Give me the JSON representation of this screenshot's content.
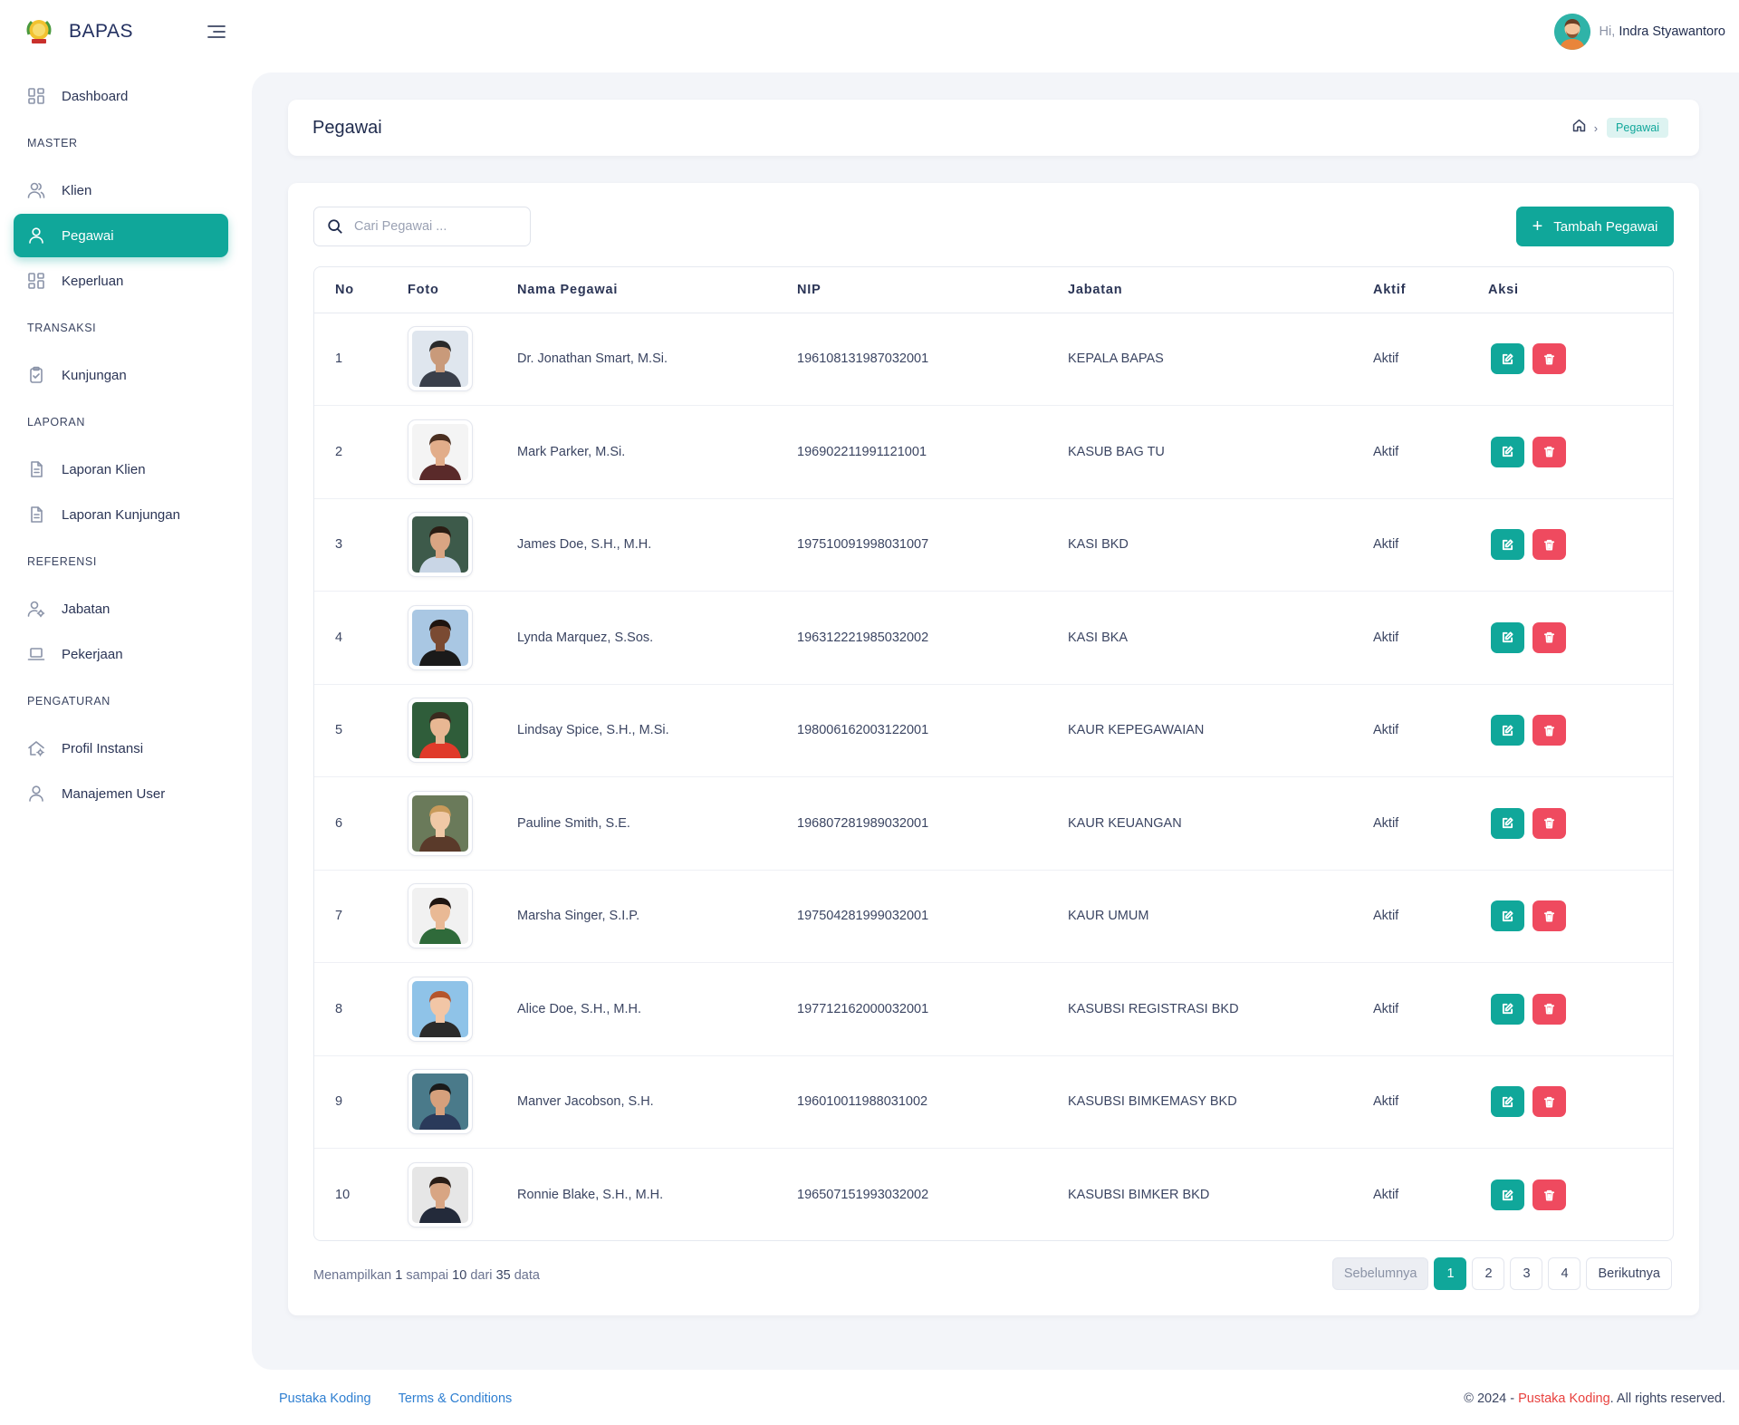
{
  "brand": {
    "name": "BAPAS"
  },
  "user": {
    "greeting": "Hi,",
    "name": "Indra Styawantoro"
  },
  "sidebar": {
    "dashboard": "Dashboard",
    "sections": {
      "master": "MASTER",
      "transaksi": "TRANSAKSI",
      "laporan": "LAPORAN",
      "referensi": "REFERENSI",
      "pengaturan": "PENGATURAN"
    },
    "items": {
      "klien": "Klien",
      "pegawai": "Pegawai",
      "keperluan": "Keperluan",
      "kunjungan": "Kunjungan",
      "laporan_klien": "Laporan Klien",
      "laporan_kunjungan": "Laporan Kunjungan",
      "jabatan": "Jabatan",
      "pekerjaan": "Pekerjaan",
      "profil_instansi": "Profil Instansi",
      "manajemen_user": "Manajemen User"
    }
  },
  "page": {
    "title": "Pegawai",
    "breadcrumb_current": "Pegawai"
  },
  "search": {
    "placeholder": "Cari Pegawai ..."
  },
  "add_button": {
    "label": "Tambah Pegawai"
  },
  "table": {
    "headers": {
      "no": "No",
      "foto": "Foto",
      "nama": "Nama Pegawai",
      "nip": "NIP",
      "jabatan": "Jabatan",
      "aktif": "Aktif",
      "aksi": "Aksi"
    },
    "rows": [
      {
        "no": "1",
        "nama": "Dr. Jonathan Smart, M.Si.",
        "nip": "196108131987032001",
        "jabatan": "KEPALA BAPAS",
        "aktif": "Aktif"
      },
      {
        "no": "2",
        "nama": "Mark Parker, M.Si.",
        "nip": "196902211991121001",
        "jabatan": "KASUB BAG TU",
        "aktif": "Aktif"
      },
      {
        "no": "3",
        "nama": "James Doe, S.H., M.H.",
        "nip": "197510091998031007",
        "jabatan": "KASI BKD",
        "aktif": "Aktif"
      },
      {
        "no": "4",
        "nama": "Lynda Marquez, S.Sos.",
        "nip": "196312221985032002",
        "jabatan": "KASI BKA",
        "aktif": "Aktif"
      },
      {
        "no": "5",
        "nama": "Lindsay Spice, S.H., M.Si.",
        "nip": "198006162003122001",
        "jabatan": "KAUR KEPEGAWAIAN",
        "aktif": "Aktif"
      },
      {
        "no": "6",
        "nama": "Pauline Smith, S.E.",
        "nip": "196807281989032001",
        "jabatan": "KAUR KEUANGAN",
        "aktif": "Aktif"
      },
      {
        "no": "7",
        "nama": "Marsha Singer, S.I.P.",
        "nip": "197504281999032001",
        "jabatan": "KAUR UMUM",
        "aktif": "Aktif"
      },
      {
        "no": "8",
        "nama": "Alice Doe, S.H., M.H.",
        "nip": "197712162000032001",
        "jabatan": "KASUBSI REGISTRASI BKD",
        "aktif": "Aktif"
      },
      {
        "no": "9",
        "nama": "Manver Jacobson, S.H.",
        "nip": "196010011988031002",
        "jabatan": "KASUBSI BIMKEMASY BKD",
        "aktif": "Aktif"
      },
      {
        "no": "10",
        "nama": "Ronnie Blake, S.H., M.H.",
        "nip": "196507151993032002",
        "jabatan": "KASUBSI BIMKER BKD",
        "aktif": "Aktif"
      }
    ]
  },
  "pagination": {
    "info_prefix": "Menampilkan",
    "from": "1",
    "info_to": "sampai",
    "to": "10",
    "info_of": "dari",
    "total": "35",
    "info_suffix": "data",
    "prev": "Sebelumnya",
    "next": "Berikutnya",
    "pages": [
      "1",
      "2",
      "3",
      "4"
    ],
    "current": "1"
  },
  "footer": {
    "links": [
      "Pustaka Koding",
      "Terms & Conditions"
    ],
    "copyright_prefix": "© 2024 -",
    "copyright_brand": "Pustaka Koding",
    "copyright_suffix": ". All rights reserved."
  },
  "colors": {
    "accent": "#10a79a",
    "danger": "#ef4a5f",
    "link": "#2f7fd1",
    "brand_red": "#e8413e"
  }
}
